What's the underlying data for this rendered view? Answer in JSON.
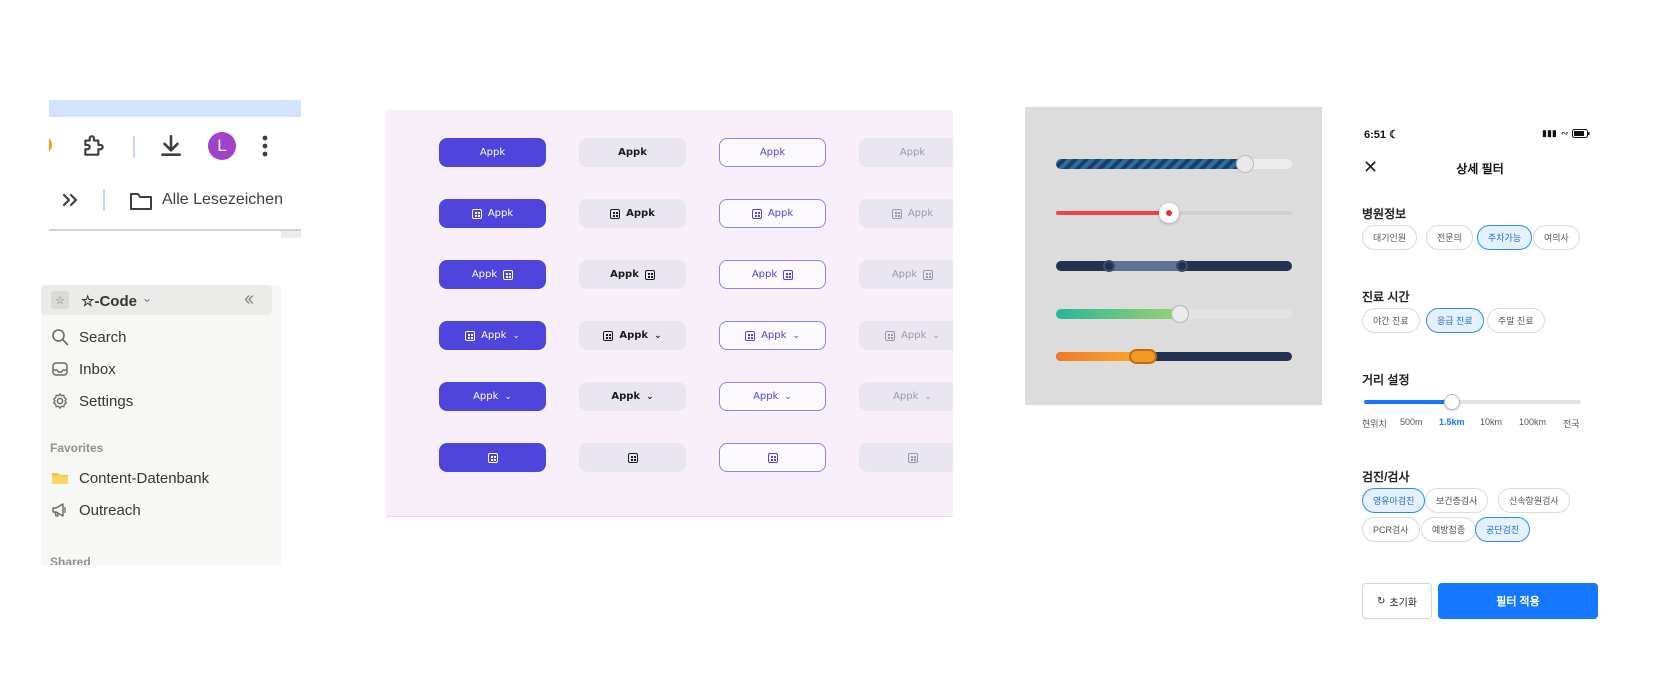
{
  "chrome_toolbar": {
    "avatar_initial": "L",
    "bookmarks_label": "Alle Lesezeichen",
    "colors": {
      "accent_bar": "#d3e3fd",
      "avatar": "#a142c9"
    }
  },
  "notion_sidebar": {
    "workspace_icon": "☆",
    "workspace_name": "☆-Code",
    "nav": [
      {
        "label": "Search",
        "icon": "search-icon"
      },
      {
        "label": "Inbox",
        "icon": "inbox-icon"
      },
      {
        "label": "Settings",
        "icon": "gear-icon"
      }
    ],
    "favorites_header": "Favorites",
    "favorites": [
      {
        "label": "Content-Datenbank",
        "icon": "folder-emoji-icon"
      },
      {
        "label": "Outreach",
        "icon": "megaphone-icon"
      }
    ],
    "shared_header": "Shared"
  },
  "button_grid": {
    "label": "Appk",
    "variants": [
      "filled",
      "tonal",
      "outline",
      "disabled"
    ],
    "rows": [
      "text",
      "leading-icon",
      "trailing-icon",
      "icon-and-dropdown",
      "text-and-dropdown",
      "icon-only"
    ],
    "colors": {
      "primary": "#4e46dc",
      "background": "#f8effa"
    }
  },
  "sliders_panel": {
    "sliders": [
      {
        "style": "striped-blue",
        "value": 0.8
      },
      {
        "style": "red-dot",
        "value": 0.48
      },
      {
        "style": "dark-range",
        "range": [
          0.23,
          0.54
        ]
      },
      {
        "style": "teal-gradient",
        "value": 0.52
      },
      {
        "style": "orange-range-pill",
        "range": [
          0.3,
          0.36
        ]
      }
    ]
  },
  "mobile_filter": {
    "time": "6:51",
    "title": "상세 필터",
    "hospital_info": {
      "title": "병원정보",
      "chips": [
        {
          "label": "대기인원",
          "selected": false
        },
        {
          "label": "전문의",
          "selected": false
        },
        {
          "label": "주차가능",
          "selected": true
        },
        {
          "label": "여의사",
          "selected": false
        }
      ]
    },
    "hours": {
      "title": "진료 시간",
      "chips": [
        {
          "label": "야간 진료",
          "selected": false
        },
        {
          "label": "응급 진료",
          "selected": true
        },
        {
          "label": "주말 진료",
          "selected": false
        }
      ]
    },
    "distance": {
      "title": "거리 설정",
      "ticks": [
        "현위치",
        "500m",
        "1.5km",
        "10km",
        "100km",
        "전국"
      ],
      "selected_index": 2
    },
    "checkup": {
      "title": "검진/검사",
      "chips": [
        {
          "label": "영유아검진",
          "selected": true
        },
        {
          "label": "보건증검사",
          "selected": false
        },
        {
          "label": "신속항원검사",
          "selected": false
        },
        {
          "label": "PCR검사",
          "selected": false
        },
        {
          "label": "예방접종",
          "selected": false
        },
        {
          "label": "공단검진",
          "selected": true
        }
      ]
    },
    "reset_label": "초기화",
    "apply_label": "필터 적용",
    "colors": {
      "accent": "#1677ff"
    }
  }
}
